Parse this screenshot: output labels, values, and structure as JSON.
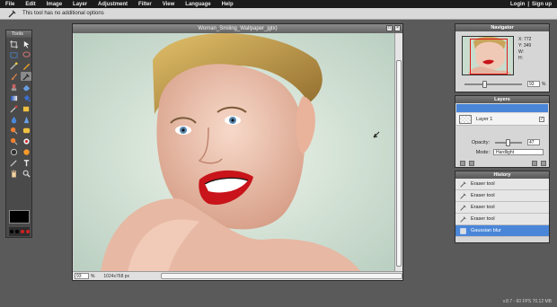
{
  "menu": [
    "File",
    "Edit",
    "Image",
    "Layer",
    "Adjustment",
    "Filter",
    "View",
    "Language",
    "Help"
  ],
  "menu_right": {
    "login": "Login",
    "separator": "|",
    "signup": "Sign up"
  },
  "options_bar": {
    "text": "This tool has no additional options"
  },
  "tools_panel": {
    "title": "Tools"
  },
  "document": {
    "title": "Woman_Smiling_Wallpaper_jgtx)",
    "zoom_value": "93",
    "zoom_unit": "%",
    "dimensions": "1024x768 px"
  },
  "navigator": {
    "title": "Navigator",
    "x_label": "X:",
    "x_value": "772",
    "y_label": "Y:",
    "y_value": "349",
    "w_label": "W:",
    "h_label": "H:",
    "zoom_value": "93",
    "zoom_unit": "%"
  },
  "layers": {
    "title": "Layers",
    "layer_name": "Layer 1",
    "opacity_label": "Opacity:",
    "opacity_value": "47",
    "mode_label": "Mode:",
    "mode_value": "Hardlight"
  },
  "history": {
    "title": "History",
    "items": [
      "Eraser tool",
      "Eraser tool",
      "Eraser tool",
      "Eraser tool",
      "Gaussian blur"
    ]
  },
  "status_text": "v.8.7 - 60 FPS 70.12 MB",
  "colors": {
    "menubar": "#1b1b1b",
    "panel_title": "#575757",
    "selection_blue": "#4a86d8",
    "background": "#5a5a5a",
    "primary_swatch": "#000000"
  }
}
